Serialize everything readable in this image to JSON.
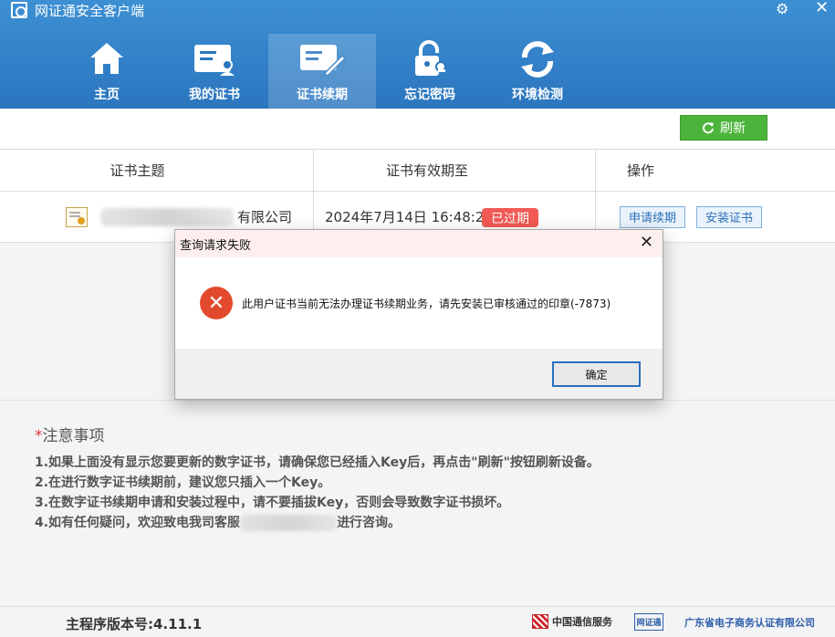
{
  "app": {
    "title": "网证通安全客户端"
  },
  "window_controls": {
    "settings_icon": "gear-icon",
    "close_glyph": "✕"
  },
  "nav": [
    {
      "label": "主页",
      "icon": "home-icon",
      "active": false
    },
    {
      "label": "我的证书",
      "icon": "certificate-card-icon",
      "active": false
    },
    {
      "label": "证书续期",
      "icon": "certificate-renew-icon",
      "active": true
    },
    {
      "label": "忘记密码",
      "icon": "lock-key-icon",
      "active": false
    },
    {
      "label": "环境检测",
      "icon": "refresh-cycle-icon",
      "active": false
    }
  ],
  "toolbar": {
    "refresh_label": "刷新"
  },
  "table": {
    "headers": [
      "证书主题",
      "证书有效期至",
      "操作"
    ],
    "rows": [
      {
        "subject_suffix": "有限公司",
        "expiry": "2024年7月14日 16:48:24",
        "status": "已过期",
        "actions": [
          "申请续期",
          "安装证书"
        ]
      }
    ]
  },
  "dialog": {
    "title": "查询请求失败",
    "message": "此用户证书当前无法办理证书续期业务，请先安装已审核通过的印章(-7873)",
    "ok_label": "确定"
  },
  "notes": {
    "star": "*",
    "title": "注意事项",
    "items": [
      "1.如果上面没有显示您要更新的数字证书，请确保您已经插入Key后，再点击\"刷新\"按钮刷新设备。",
      "2.在进行数字证书续期前，建议您只插入一个Key。",
      "3.在数字证书续期申请和安装过程中，请不要插拔Key，否则会导致数字证书损坏。"
    ],
    "item4_prefix": "4.如有任何疑问，欢迎致电我司客服",
    "item4_suffix": "进行咨询。"
  },
  "footer": {
    "version": "主程序版本号:4.11.1",
    "logo_cc": "中国通信服务",
    "logo_ca": "网证通",
    "logo_gd": "广东省电子商务认证有限公司"
  },
  "colors": {
    "header": "#2b76bf",
    "refresh": "#4cb43a",
    "expired": "#f25a55",
    "error": "#e3492d"
  }
}
